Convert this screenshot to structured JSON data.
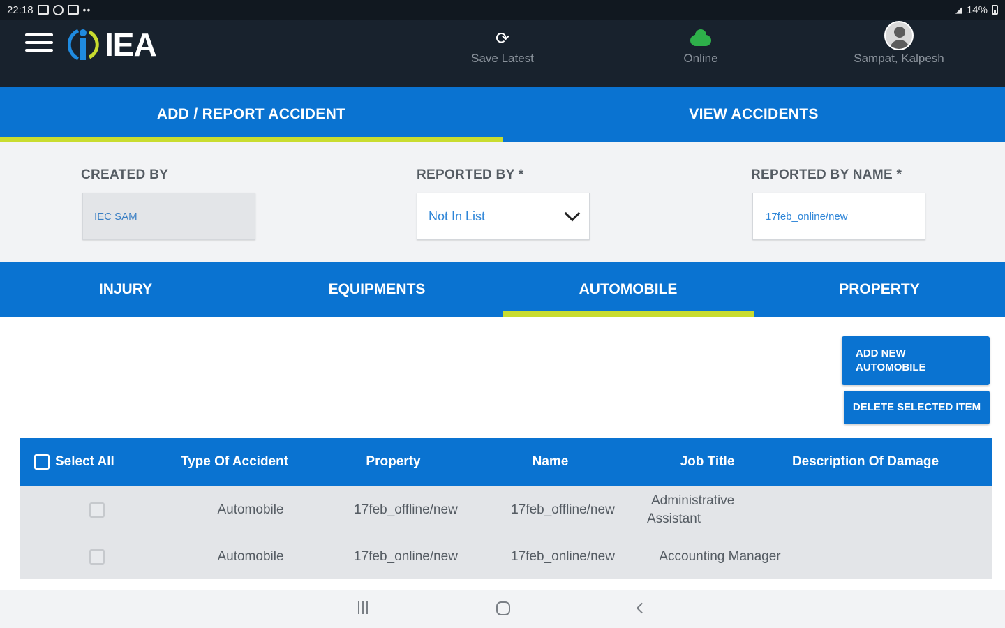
{
  "status_bar": {
    "time": "22:18",
    "battery": "14%"
  },
  "header": {
    "logo_text": "IEA",
    "sync_label": "Save Latest",
    "online_label": "Online",
    "user_name": "Sampat, Kalpesh"
  },
  "main_tabs": [
    {
      "label": "ADD / REPORT ACCIDENT",
      "active": true
    },
    {
      "label": "VIEW ACCIDENTS",
      "active": false
    }
  ],
  "form": {
    "created_by_label": "CREATED BY",
    "created_by_value": "IEC SAM",
    "reported_by_label": "REPORTED BY *",
    "reported_by_value": "Not In List",
    "reported_by_name_label": "REPORTED BY NAME *",
    "reported_by_name_value": "17feb_online/new"
  },
  "sub_tabs": [
    {
      "label": "INJURY",
      "active": false
    },
    {
      "label": "EQUIPMENTS",
      "active": false
    },
    {
      "label": "AUTOMOBILE",
      "active": true
    },
    {
      "label": "PROPERTY",
      "active": false
    }
  ],
  "actions": {
    "add_new_line1": "ADD NEW",
    "add_new_line2": "AUTOMOBILE",
    "delete_selected": "DELETE SELECTED ITEM"
  },
  "table": {
    "headers": {
      "select_all": "Select All",
      "type": "Type Of Accident",
      "property": "Property",
      "name": "Name",
      "job_title": "Job Title",
      "description": "Description Of Damage"
    },
    "rows": [
      {
        "type": "Automobile",
        "property": "17feb_offline/new",
        "name": "17feb_offline/new",
        "job_title_line1": "Administrative",
        "job_title_line2": "Assistant",
        "description": ""
      },
      {
        "type": "Automobile",
        "property": "17feb_online/new",
        "name": "17feb_online/new",
        "job_title": "Accounting Manager",
        "description": ""
      }
    ]
  },
  "colors": {
    "primary_blue": "#0a73d1",
    "accent_lime": "#c9dc2f",
    "header_dark": "#18222d",
    "online_green": "#2eb04a"
  }
}
